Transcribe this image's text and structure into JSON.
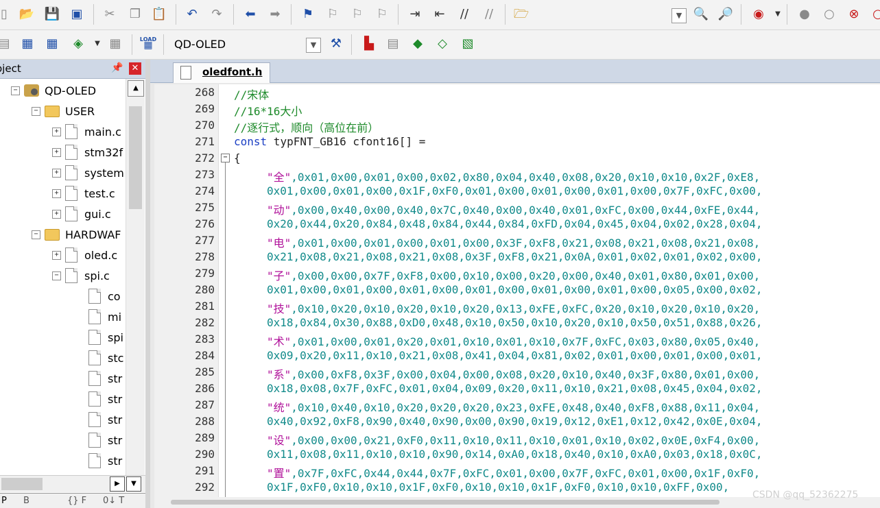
{
  "toolbar1": {
    "icons": [
      "new-file-icon",
      "open-file-icon",
      "save-icon",
      "save-all-icon",
      "cut-icon",
      "copy-icon",
      "paste-icon",
      "undo-icon",
      "redo-icon",
      "navigate-back-icon",
      "navigate-forward-icon",
      "bookmark-icon",
      "bookmark-prev-icon",
      "bookmark-next-icon",
      "bookmark-clear-icon",
      "indent-icon",
      "unindent-icon",
      "comment-icon",
      "uncomment-icon",
      "find-in-files-icon",
      "find-icon",
      "debug-icon",
      "breakpoint-icon",
      "breakpoint-disable-icon",
      "breakpoint-kill-icon"
    ]
  },
  "toolbar2": {
    "target_value": "QD-OLED",
    "load_label": "LOAD"
  },
  "project_panel": {
    "title": "oject",
    "tree": [
      {
        "label": "QD-OLED",
        "type": "root"
      },
      {
        "label": "USER",
        "type": "folder"
      },
      {
        "label": "main.c",
        "type": "file"
      },
      {
        "label": "stm32f",
        "type": "file"
      },
      {
        "label": "system",
        "type": "file"
      },
      {
        "label": "test.c",
        "type": "file"
      },
      {
        "label": "gui.c",
        "type": "file"
      },
      {
        "label": "HARDWAF",
        "type": "folder"
      },
      {
        "label": "oled.c",
        "type": "file"
      },
      {
        "label": "spi.c",
        "type": "file"
      },
      {
        "label": "co",
        "type": "subfile"
      },
      {
        "label": "mi",
        "type": "subfile"
      },
      {
        "label": "spi",
        "type": "subfile"
      },
      {
        "label": "stc",
        "type": "subfile"
      },
      {
        "label": "str",
        "type": "subfile"
      },
      {
        "label": "str",
        "type": "subfile"
      },
      {
        "label": "str",
        "type": "subfile"
      },
      {
        "label": "str",
        "type": "subfile"
      },
      {
        "label": "str",
        "type": "subfile"
      }
    ],
    "bottom_tabs": [
      "P",
      "B",
      "{} F",
      "0↓ T"
    ]
  },
  "editor": {
    "tab_label": "oledfont.h",
    "lines": [
      {
        "num": "268",
        "kind": "comment",
        "text": "//宋体"
      },
      {
        "num": "269",
        "kind": "comment",
        "text": "//16*16大小"
      },
      {
        "num": "270",
        "kind": "comment",
        "text": "//逐行式，顺向（高位在前）"
      },
      {
        "num": "271",
        "kind": "decl",
        "kw": "const",
        "text": " typFNT_GB16 cfont16[] ="
      },
      {
        "num": "272",
        "kind": "plain",
        "text": "{"
      },
      {
        "num": "273",
        "kind": "data",
        "str": "\"全\"",
        "text": ",0x01,0x00,0x01,0x00,0x02,0x80,0x04,0x40,0x08,0x20,0x10,0x10,0x2F,0xE8,"
      },
      {
        "num": "274",
        "kind": "data",
        "str": "",
        "text": "0x01,0x00,0x01,0x00,0x1F,0xF0,0x01,0x00,0x01,0x00,0x01,0x00,0x7F,0xFC,0x00,"
      },
      {
        "num": "275",
        "kind": "data",
        "str": "\"动\"",
        "text": ",0x00,0x40,0x00,0x40,0x7C,0x40,0x00,0x40,0x01,0xFC,0x00,0x44,0xFE,0x44,"
      },
      {
        "num": "276",
        "kind": "data",
        "str": "",
        "text": "0x20,0x44,0x20,0x84,0x48,0x84,0x44,0x84,0xFD,0x04,0x45,0x04,0x02,0x28,0x04,"
      },
      {
        "num": "277",
        "kind": "data",
        "str": "\"电\"",
        "text": ",0x01,0x00,0x01,0x00,0x01,0x00,0x3F,0xF8,0x21,0x08,0x21,0x08,0x21,0x08,"
      },
      {
        "num": "278",
        "kind": "data",
        "str": "",
        "text": "0x21,0x08,0x21,0x08,0x21,0x08,0x3F,0xF8,0x21,0x0A,0x01,0x02,0x01,0x02,0x00,"
      },
      {
        "num": "279",
        "kind": "data",
        "str": "\"子\"",
        "text": ",0x00,0x00,0x7F,0xF8,0x00,0x10,0x00,0x20,0x00,0x40,0x01,0x80,0x01,0x00,"
      },
      {
        "num": "280",
        "kind": "data",
        "str": "",
        "text": "0x01,0x00,0x01,0x00,0x01,0x00,0x01,0x00,0x01,0x00,0x01,0x00,0x05,0x00,0x02,"
      },
      {
        "num": "281",
        "kind": "data",
        "str": "\"技\"",
        "text": ",0x10,0x20,0x10,0x20,0x10,0x20,0x13,0xFE,0xFC,0x20,0x10,0x20,0x10,0x20,"
      },
      {
        "num": "282",
        "kind": "data",
        "str": "",
        "text": "0x18,0x84,0x30,0x88,0xD0,0x48,0x10,0x50,0x10,0x20,0x10,0x50,0x51,0x88,0x26,"
      },
      {
        "num": "283",
        "kind": "data",
        "str": "\"术\"",
        "text": ",0x01,0x00,0x01,0x20,0x01,0x10,0x01,0x10,0x7F,0xFC,0x03,0x80,0x05,0x40,"
      },
      {
        "num": "284",
        "kind": "data",
        "str": "",
        "text": "0x09,0x20,0x11,0x10,0x21,0x08,0x41,0x04,0x81,0x02,0x01,0x00,0x01,0x00,0x01,"
      },
      {
        "num": "285",
        "kind": "data",
        "str": "\"系\"",
        "text": ",0x00,0xF8,0x3F,0x00,0x04,0x00,0x08,0x20,0x10,0x40,0x3F,0x80,0x01,0x00,"
      },
      {
        "num": "286",
        "kind": "data",
        "str": "",
        "text": "0x18,0x08,0x7F,0xFC,0x01,0x04,0x09,0x20,0x11,0x10,0x21,0x08,0x45,0x04,0x02,"
      },
      {
        "num": "287",
        "kind": "data",
        "str": "\"统\"",
        "text": ",0x10,0x40,0x10,0x20,0x20,0x20,0x23,0xFE,0x48,0x40,0xF8,0x88,0x11,0x04,"
      },
      {
        "num": "288",
        "kind": "data",
        "str": "",
        "text": "0x40,0x92,0xF8,0x90,0x40,0x90,0x00,0x90,0x19,0x12,0xE1,0x12,0x42,0x0E,0x04,"
      },
      {
        "num": "289",
        "kind": "data",
        "str": "\"设\"",
        "text": ",0x00,0x00,0x21,0xF0,0x11,0x10,0x11,0x10,0x01,0x10,0x02,0x0E,0xF4,0x00,"
      },
      {
        "num": "290",
        "kind": "data",
        "str": "",
        "text": "0x11,0x08,0x11,0x10,0x10,0x90,0x14,0xA0,0x18,0x40,0x10,0xA0,0x03,0x18,0x0C,"
      },
      {
        "num": "291",
        "kind": "data",
        "str": "\"置\"",
        "text": ",0x7F,0xFC,0x44,0x44,0x7F,0xFC,0x01,0x00,0x7F,0xFC,0x01,0x00,0x1F,0xF0,"
      },
      {
        "num": "292",
        "kind": "data",
        "str": "",
        "text": "0x1F,0xF0,0x10,0x10,0x1F,0xF0,0x10,0x10,0x1F,0xF0,0x10,0x10,0xFF,0x00,"
      }
    ]
  },
  "watermark": "CSDN @qq_52362275"
}
